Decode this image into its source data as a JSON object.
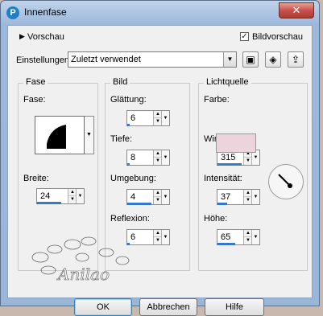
{
  "window": {
    "title": "Innenfase",
    "close_symbol": "✕"
  },
  "top": {
    "preview_toggle": "Vorschau",
    "bild_preview_label": "Bildvorschau",
    "bild_preview_checked": true
  },
  "settings": {
    "label": "Einstellungen",
    "preset_value": "Zuletzt verwendet"
  },
  "fase_group": {
    "title": "Fase",
    "fase_label": "Fase:",
    "breite_label": "Breite:",
    "breite_value": "24"
  },
  "bild_group": {
    "title": "Bild",
    "glaettung_label": "Glättung:",
    "glaettung_value": "6",
    "tiefe_label": "Tiefe:",
    "tiefe_value": "8",
    "umgebung_label": "Umgebung:",
    "umgebung_value": "4",
    "reflexion_label": "Reflexion:",
    "reflexion_value": "6"
  },
  "light_group": {
    "title": "Lichtquelle",
    "farbe_label": "Farbe:",
    "farbe_color": "#ebd4dc",
    "winkel_label": "Winkel:",
    "winkel_value": "315",
    "intensitaet_label": "Intensität:",
    "intensitaet_value": "37",
    "hoehe_label": "Höhe:",
    "hoehe_value": "65"
  },
  "buttons": {
    "ok": "OK",
    "cancel": "Abbrechen",
    "help": "Hilfe"
  },
  "watermark": {
    "text": "Anilao"
  }
}
